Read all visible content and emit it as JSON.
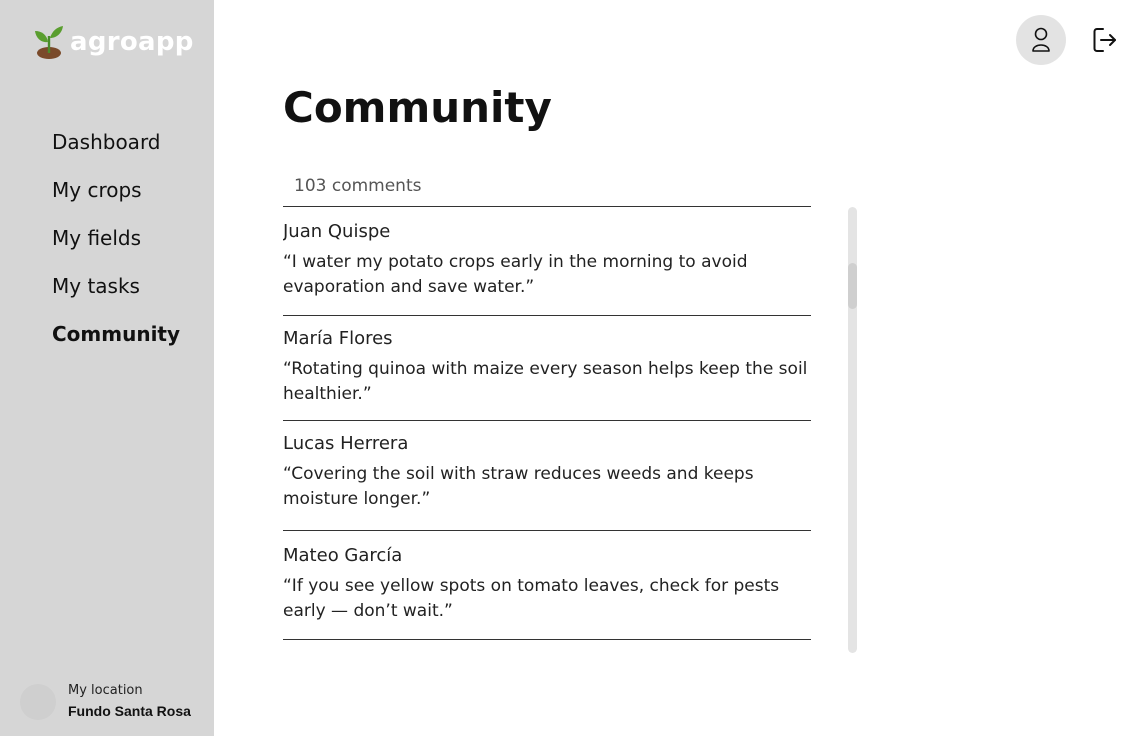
{
  "app": {
    "name": "agroapp"
  },
  "sidebar": {
    "items": [
      {
        "label": "Dashboard",
        "active": false
      },
      {
        "label": "My crops",
        "active": false
      },
      {
        "label": "My fields",
        "active": false
      },
      {
        "label": "My tasks",
        "active": false
      },
      {
        "label": "Community",
        "active": true
      }
    ],
    "location": {
      "label": "My location",
      "value": "Fundo Santa Rosa"
    }
  },
  "header": {
    "profile_icon": "user-icon",
    "logout_icon": "logout-icon"
  },
  "main": {
    "title": "Community",
    "comments_count": "103 comments",
    "comments": [
      {
        "author": "Juan Quispe",
        "text": "“I water my potato crops early in the morning to avoid evaporation and save water.”"
      },
      {
        "author": "María Flores",
        "text": "“Rotating quinoa with maize every season helps keep the soil healthier.”"
      },
      {
        "author": "Lucas Herrera",
        "text": "“Covering the soil with straw reduces weeds and keeps moisture longer.”"
      },
      {
        "author": "Mateo García",
        "text": "“If you see yellow spots on tomato leaves, check for pests early — don’t wait.”"
      }
    ]
  },
  "colors": {
    "sidebar_bg": "#d6d6d6",
    "brand_text": "#ffffff",
    "sprout_green": "#4a8c2a",
    "soil_brown": "#7a4a2a"
  }
}
